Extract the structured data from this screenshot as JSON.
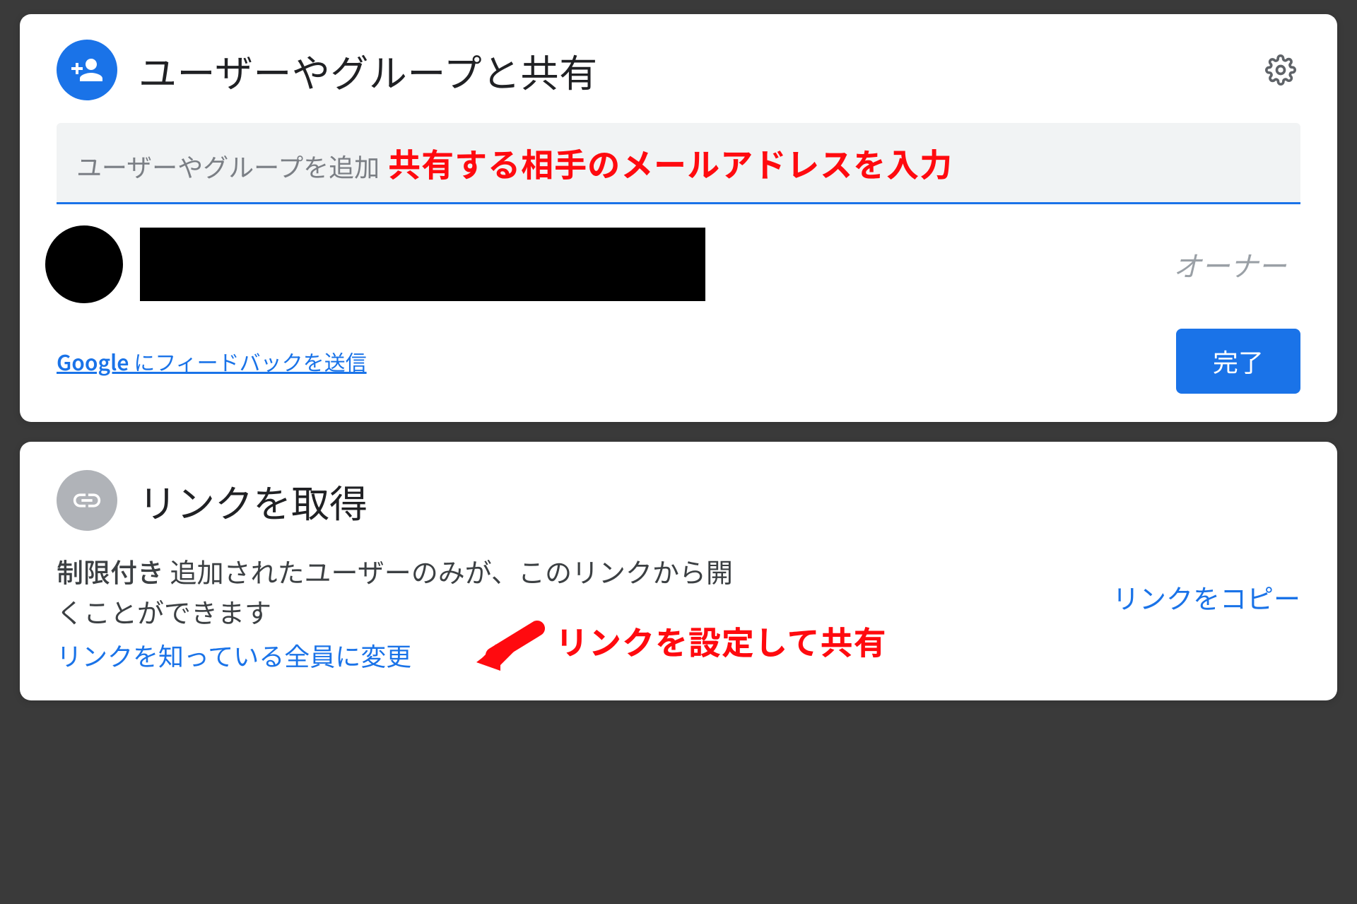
{
  "share": {
    "title": "ユーザーやグループと共有",
    "input_placeholder": "ユーザーやグループを追加",
    "annotation_input": "共有する相手のメールアドレスを入力",
    "owner_role": "オーナー",
    "feedback_brand": "Google",
    "feedback_rest": " にフィードバックを送信",
    "done_button": "完了"
  },
  "link": {
    "title": "リンクを取得",
    "restricted_label": "制限付き",
    "restricted_desc": " 追加されたユーザーのみが、このリンクから開くことができます",
    "change_link": "リンクを知っている全員に変更",
    "annotation_link": "リンクを設定して共有",
    "copy_link": "リンクをコピー"
  },
  "icons": {
    "person_add": "person-add-icon",
    "gear": "gear-icon",
    "link": "link-icon",
    "arrow": "arrow-icon"
  }
}
